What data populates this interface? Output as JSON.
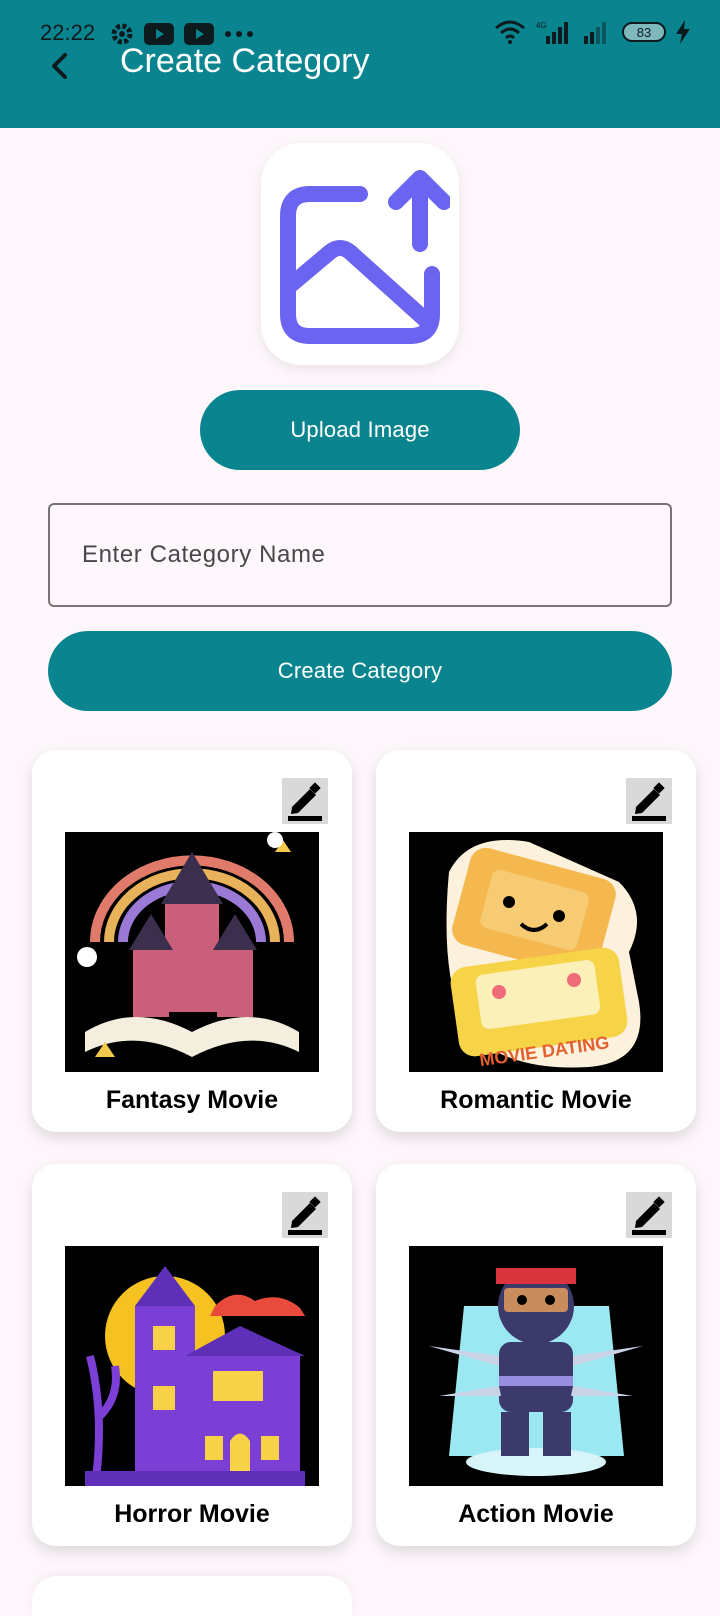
{
  "status_bar": {
    "time": "22:22",
    "battery": "83",
    "network": "4G"
  },
  "app_bar": {
    "title": "Create Category"
  },
  "upload": {
    "button_label": "Upload Image"
  },
  "form": {
    "placeholder": "Enter Category Name",
    "value": ""
  },
  "create": {
    "button_label": "Create Category"
  },
  "categories": [
    {
      "label": "Fantasy Movie"
    },
    {
      "label": "Romantic Movie"
    },
    {
      "label": "Horror Movie"
    },
    {
      "label": "Action Movie"
    }
  ],
  "colors": {
    "primary": "#0a8590",
    "accent_icon": "#6a64f1",
    "background": "#fdf7fb"
  }
}
